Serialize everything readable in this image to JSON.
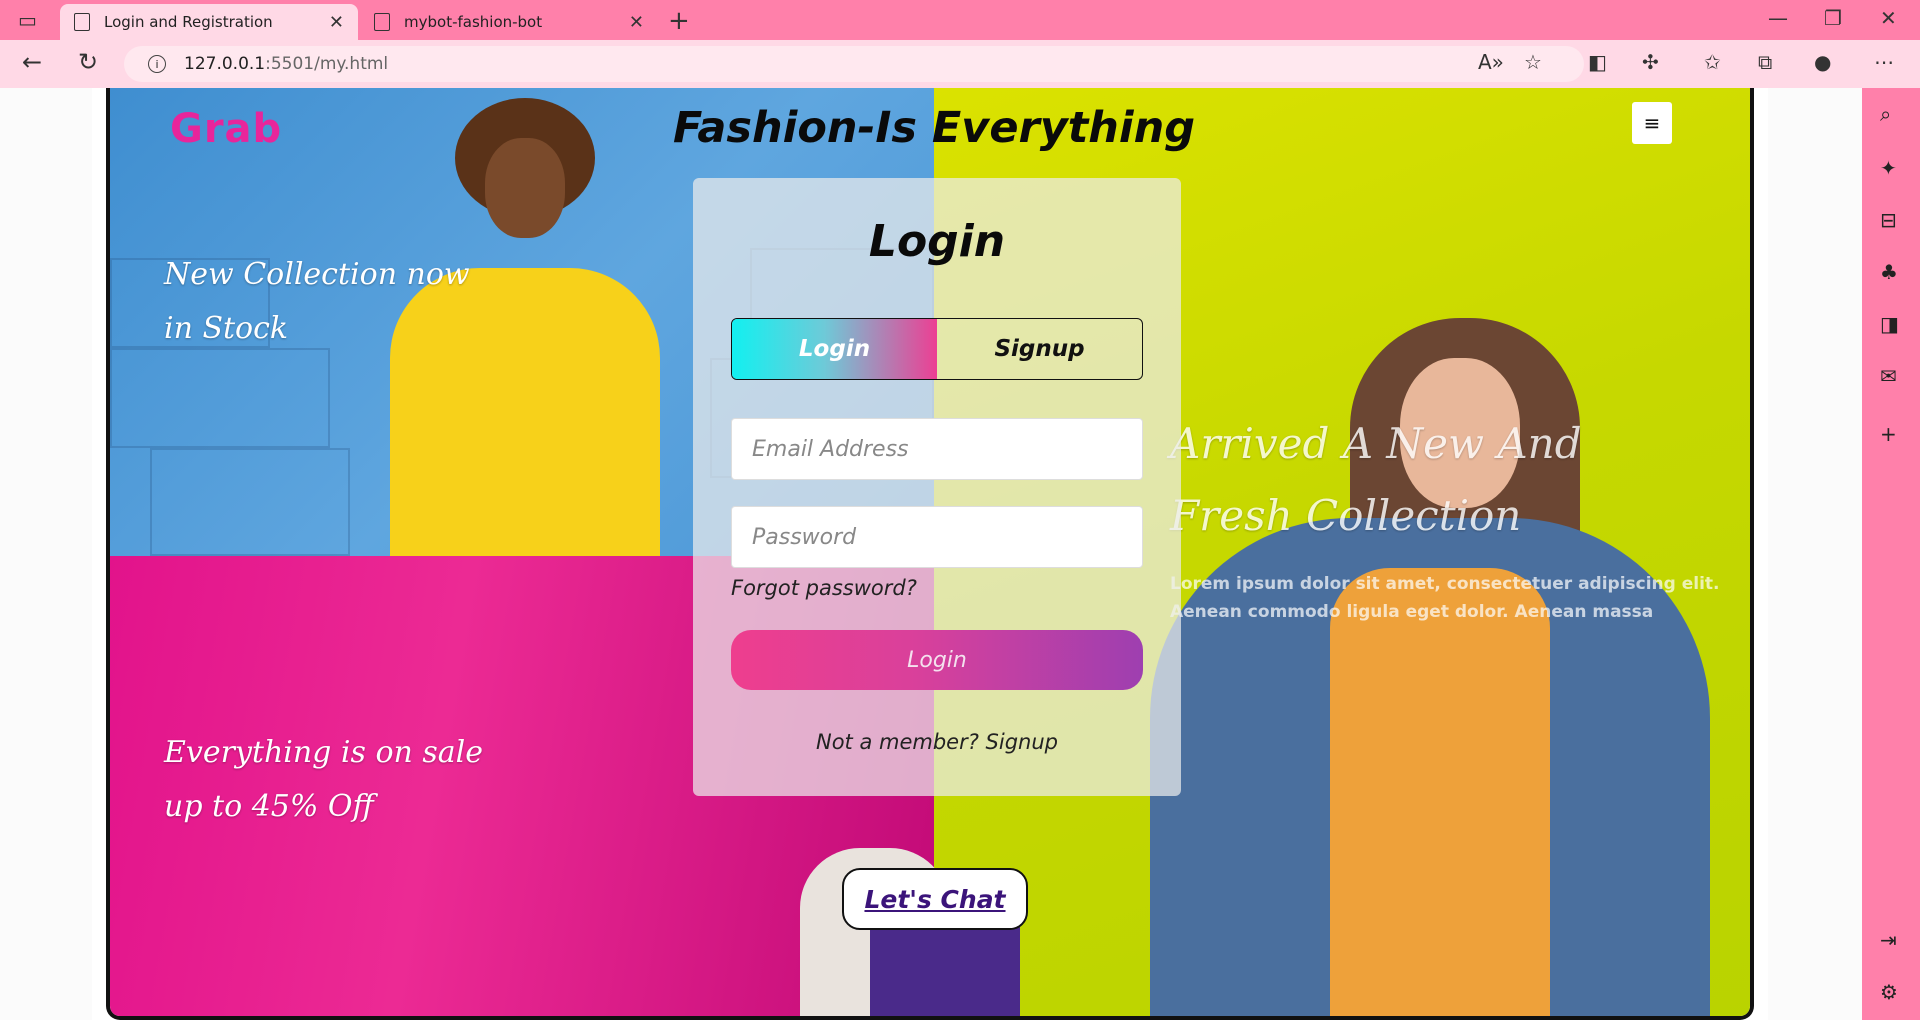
{
  "browser": {
    "tabs": [
      {
        "title": "Login and Registration",
        "active": true
      },
      {
        "title": "mybot-fashion-bot",
        "active": false
      }
    ],
    "url_host": "127.0.0.1",
    "url_path": ":5501/my.html",
    "accent_color": "#ff80aa"
  },
  "site": {
    "brand": "Grab",
    "title": "Fashion-Is Everything",
    "menu_icon": "hamburger-icon"
  },
  "promos": {
    "p1_line1": "New Collection now",
    "p1_line2": "in Stock",
    "p2_line1": "Everything is on sale",
    "p2_line2": "up to 45% Off",
    "p3_line1": "Arrived A New And",
    "p3_line2": "Fresh Collection",
    "lorem_line1": "Lorem ipsum dolor sit amet, consectetuer adipiscing elit.",
    "lorem_line2": "Aenean commodo ligula eget dolor. Aenean massa"
  },
  "login": {
    "heading": "Login",
    "toggle_login": "Login",
    "toggle_signup": "Signup",
    "email_placeholder": "Email Address",
    "password_placeholder": "Password",
    "forgot": "Forgot password?",
    "submit": "Login",
    "not_member": "Not a member?",
    "signup_link": "Signup"
  },
  "chat": {
    "label": "Let's Chat"
  }
}
